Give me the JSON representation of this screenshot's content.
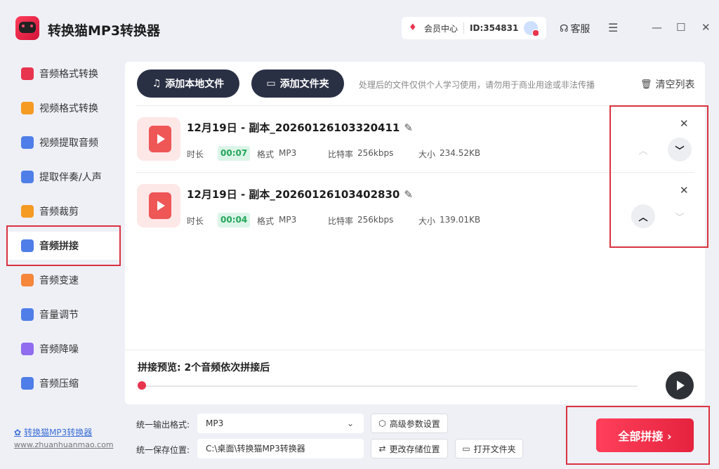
{
  "app": {
    "title": "转换猫MP3转换器",
    "vip_label": "会员中心",
    "user_id": "ID:354831",
    "support_label": "客服"
  },
  "icons": {
    "vip": "diamond-icon",
    "support": "headset-icon",
    "menu": "hamburger-icon",
    "minimize": "minimize-icon",
    "maximize": "maximize-icon",
    "close": "close-icon"
  },
  "sidebar": {
    "items": [
      {
        "label": "音频格式转换",
        "color": "#e8344e"
      },
      {
        "label": "视频格式转换",
        "color": "#f59a23"
      },
      {
        "label": "视频提取音频",
        "color": "#4f7ee8"
      },
      {
        "label": "提取伴奏/人声",
        "color": "#4f7ee8"
      },
      {
        "label": "音频裁剪",
        "color": "#f59a23"
      },
      {
        "label": "音频拼接",
        "color": "#4f7ee8"
      },
      {
        "label": "音频变速",
        "color": "#f5863a"
      },
      {
        "label": "音量调节",
        "color": "#4f7ee8"
      },
      {
        "label": "音频降噪",
        "color": "#8f6cf0"
      },
      {
        "label": "音频压缩",
        "color": "#4f7ee8"
      }
    ],
    "active_index": 5,
    "footer_link": "转换猫MP3转换器",
    "footer_url": "www.zhuanhuanmao.com"
  },
  "toolbar": {
    "add_local_files": "添加本地文件",
    "add_folder": "添加文件夹",
    "notice": "处理后的文件仅供个人学习使用，请勿用于商业用途或非法传播",
    "clear_list": "清空列表"
  },
  "files": [
    {
      "name": "12月19日 - 副本_20260126103320411",
      "duration_label": "时长",
      "duration": "00:07",
      "format_label": "格式",
      "format": "MP3",
      "bitrate_label": "比特率",
      "bitrate": "256kbps",
      "size_label": "大小",
      "size": "234.52KB"
    },
    {
      "name": "12月19日 - 副本_20260126103402830",
      "duration_label": "时长",
      "duration": "00:04",
      "format_label": "格式",
      "format": "MP3",
      "bitrate_label": "比特率",
      "bitrate": "256kbps",
      "size_label": "大小",
      "size": "139.01KB"
    }
  ],
  "preview": {
    "title": "拼接预览: 2个音频依次拼接后",
    "progress": 0
  },
  "output": {
    "format_label": "统一输出格式:",
    "format_value": "MP3",
    "advanced_settings": "高级参数设置",
    "save_label": "统一保存位置:",
    "save_path": "C:\\桌面\\转换猫MP3转换器",
    "change_location": "更改存储位置",
    "open_folder": "打开文件夹"
  },
  "merge_button": "全部拼接 ›",
  "colors": {
    "accent": "#e8344e",
    "dark_button": "#2a3044",
    "duration_badge": "#23a55a"
  }
}
